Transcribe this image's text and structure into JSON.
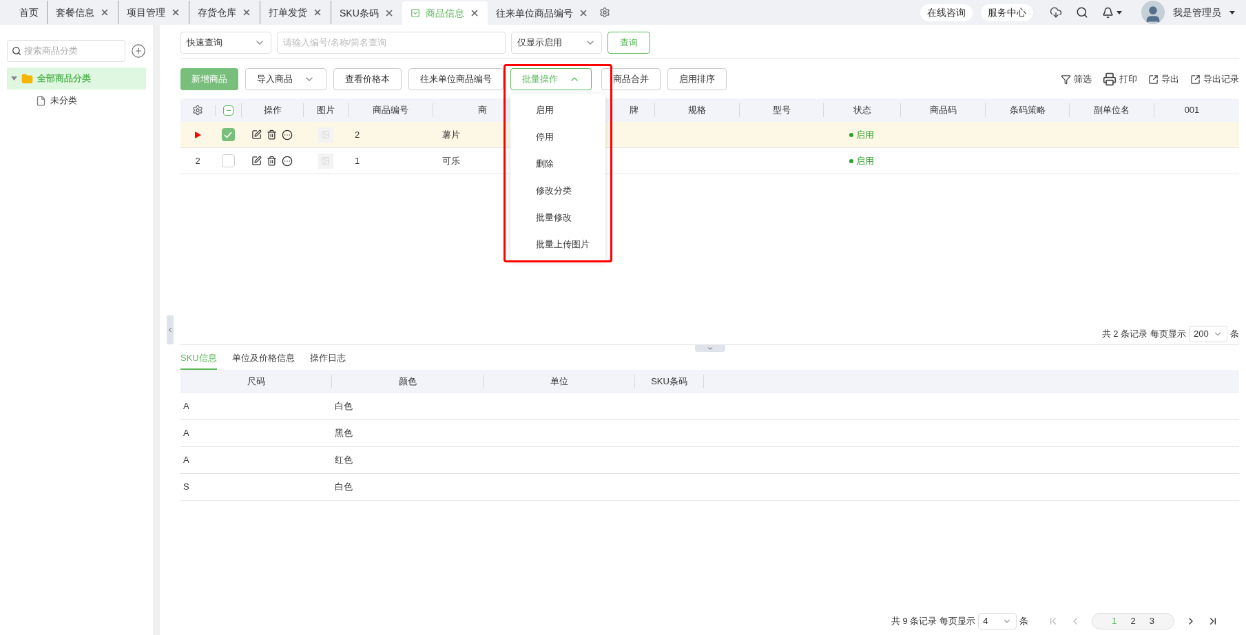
{
  "tabs": [
    {
      "label": "首页",
      "selected": false,
      "closable": false
    },
    {
      "label": "套餐信息",
      "selected": false,
      "closable": true
    },
    {
      "label": "项目管理",
      "selected": false,
      "closable": true
    },
    {
      "label": "存货仓库",
      "selected": false,
      "closable": true
    },
    {
      "label": "打单发货",
      "selected": false,
      "closable": true
    },
    {
      "label": "SKU条码",
      "selected": false,
      "closable": true
    },
    {
      "label": "商品信息",
      "selected": true,
      "closable": true
    },
    {
      "label": "往来单位商品编号",
      "selected": false,
      "closable": true
    }
  ],
  "header": {
    "links": [
      "在线咨询",
      "服务中心"
    ],
    "user": "我是管理员"
  },
  "sidebar": {
    "search": {
      "placeholder": "搜索商品分类"
    },
    "tree": [
      {
        "label": "全部商品分类",
        "selected": true,
        "expanded": true,
        "children": [
          {
            "label": "未分类",
            "selected": false
          }
        ]
      }
    ]
  },
  "query": {
    "mode": "快速查询",
    "search": {
      "placeholder": "请输入编号/名称/简名查询"
    },
    "filter": "仅显示启用",
    "button": "查询"
  },
  "toolbar": {
    "buttons": [
      {
        "label": "新增商品",
        "kind": "primary"
      },
      {
        "label": "导入商品",
        "kind": "split"
      },
      {
        "label": "查看价格本",
        "kind": "plain"
      },
      {
        "label": "往来单位商品编号",
        "kind": "plain"
      },
      {
        "label": "批量操作",
        "kind": "menu",
        "expanded": true
      },
      {
        "label": "商品合并",
        "kind": "plain"
      },
      {
        "label": "启用排序",
        "kind": "plain"
      }
    ],
    "menu": [
      "启用",
      "停用",
      "删除",
      "修改分类",
      "批量修改",
      "批量上传图片"
    ],
    "actions": [
      {
        "label": "筛选",
        "kind": "filter"
      },
      {
        "label": "打印",
        "kind": "print"
      },
      {
        "label": "导出",
        "kind": "export"
      },
      {
        "label": "导出记录",
        "kind": "export"
      }
    ]
  },
  "table": {
    "columns": [
      "操作",
      "图片",
      "商品编号",
      "商",
      "牌",
      "规格",
      "型号",
      "状态",
      "商品码",
      "条码策略",
      "副单位名",
      "001"
    ],
    "header_checkbox_partial": true,
    "rows": [
      {
        "current": true,
        "selected": true,
        "checked": true,
        "code": "2",
        "name": "薯片",
        "status": "启用"
      },
      {
        "current": false,
        "index": "2",
        "selected": false,
        "checked": false,
        "code": "1",
        "name": "可乐",
        "status": "启用"
      }
    ],
    "footer": {
      "total": "共 2 条记录",
      "per_page_label": "每页显示",
      "per_page": "200",
      "unit": "条"
    }
  },
  "detail": {
    "tabs": [
      {
        "label": "SKU信息",
        "selected": true
      },
      {
        "label": "单位及价格信息",
        "selected": false
      },
      {
        "label": "操作日志",
        "selected": false
      }
    ],
    "columns": [
      "尺码",
      "颜色",
      "单位",
      "SKU条码"
    ],
    "rows": [
      [
        "A",
        "白色"
      ],
      [
        "A",
        "黑色"
      ],
      [
        "A",
        "红色"
      ],
      [
        "S",
        "白色"
      ]
    ],
    "pager": {
      "total": "共 9 条记录",
      "per_page_label": "每页显示",
      "per_page": "4",
      "unit": "条",
      "pages": [
        {
          "label": "1",
          "selected": true
        },
        {
          "label": "2",
          "selected": false
        },
        {
          "label": "3",
          "selected": false
        }
      ]
    }
  }
}
